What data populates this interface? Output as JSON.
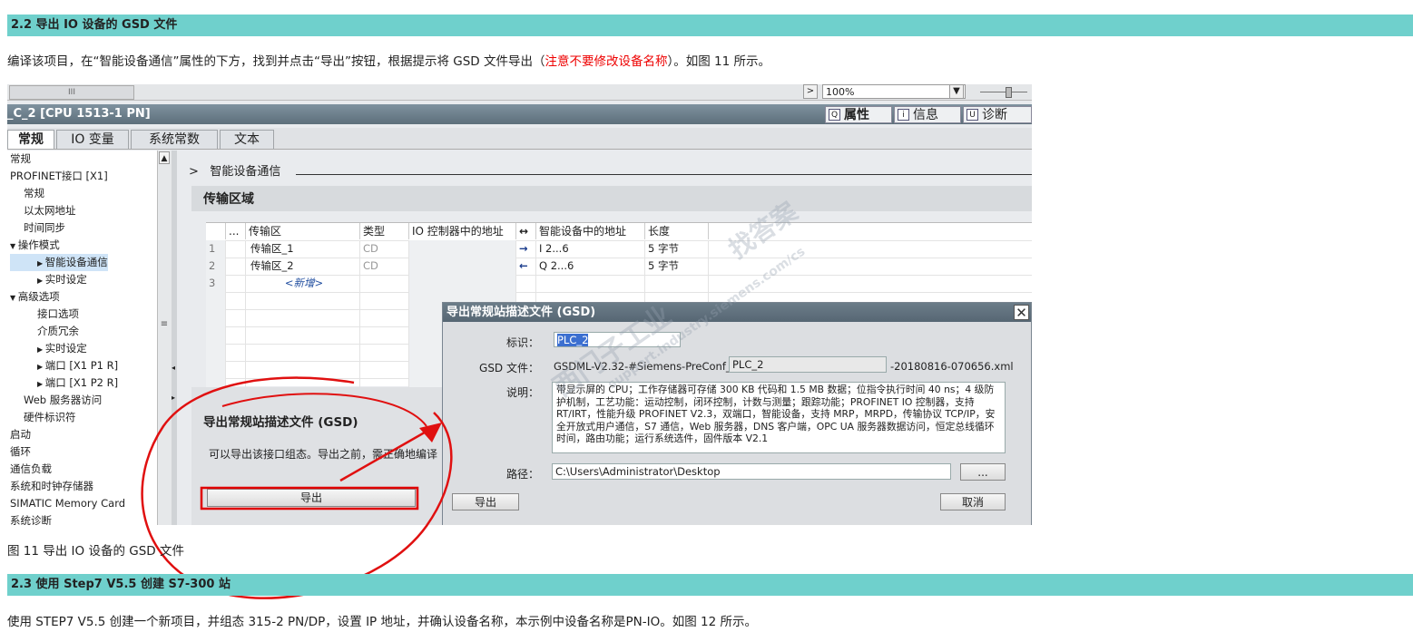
{
  "sec1": {
    "title": "2.2 导出 IO 设备的 GSD 文件"
  },
  "intro": {
    "before": "编译该项目，在“智能设备通信”属性的下方，找到并点击“导出”按钮，根据提示将 GSD 文件导出（",
    "red": "注意不要修改设备名称",
    "after": "）。如图 11 所示。"
  },
  "toolbar": {
    "scroll_glyph": "III",
    "nav_arrow": ">",
    "zoom": "100%",
    "zoom_arrow": "▼"
  },
  "window": {
    "title": "_C_2 [CPU 1513-1 PN]"
  },
  "panel_tabs": [
    {
      "icon": "Q",
      "label": "属性"
    },
    {
      "icon": "i",
      "label": "信息"
    },
    {
      "icon": "U",
      "label": "诊断"
    }
  ],
  "tabs": [
    "常规",
    "IO 变量",
    "系统常数",
    "文本"
  ],
  "tree": [
    {
      "label": "常规",
      "indent": 0,
      "arrow": ""
    },
    {
      "label": "PROFINET接口 [X1]",
      "indent": 0,
      "arrow": ""
    },
    {
      "label": "常规",
      "indent": 1,
      "arrow": ""
    },
    {
      "label": "以太网地址",
      "indent": 1,
      "arrow": ""
    },
    {
      "label": "时间同步",
      "indent": 1,
      "arrow": ""
    },
    {
      "label": "操作模式",
      "indent": 0,
      "arrow": "▼"
    },
    {
      "label": "智能设备通信",
      "indent": 2,
      "arrow": "▶",
      "selected": true
    },
    {
      "label": "实时设定",
      "indent": 2,
      "arrow": "▶"
    },
    {
      "label": "高级选项",
      "indent": 0,
      "arrow": "▼"
    },
    {
      "label": "接口选项",
      "indent": 2,
      "arrow": ""
    },
    {
      "label": "介质冗余",
      "indent": 2,
      "arrow": ""
    },
    {
      "label": "实时设定",
      "indent": 2,
      "arrow": "▶"
    },
    {
      "label": "端口 [X1 P1 R]",
      "indent": 2,
      "arrow": "▶"
    },
    {
      "label": "端口 [X1 P2 R]",
      "indent": 2,
      "arrow": "▶"
    },
    {
      "label": "Web 服务器访问",
      "indent": 1,
      "arrow": ""
    },
    {
      "label": "硬件标识符",
      "indent": 1,
      "arrow": ""
    },
    {
      "label": "启动",
      "indent": 0,
      "arrow": ""
    },
    {
      "label": "循环",
      "indent": 0,
      "arrow": ""
    },
    {
      "label": "通信负载",
      "indent": 0,
      "arrow": ""
    },
    {
      "label": "系统和时钟存储器",
      "indent": 0,
      "arrow": ""
    },
    {
      "label": "SIMATIC Memory Card",
      "indent": 0,
      "arrow": ""
    },
    {
      "label": "系统诊断",
      "indent": 0,
      "arrow": ""
    }
  ],
  "content": {
    "breadcrumb_arrow": ">",
    "breadcrumb": "智能设备通信",
    "section_title": "传输区域",
    "export_title": "导出常规站描述文件 (GSD)",
    "export_desc": "可以导出该接口组态。导出之前，需正确地编译",
    "export_button": "导出"
  },
  "grid": {
    "headers": [
      "",
      "...",
      "传输区",
      "类型",
      "IO 控制器中的地址",
      "↔",
      "智能设备中的地址",
      "长度"
    ],
    "rows": [
      {
        "num": "1",
        "name": "传输区_1",
        "type": "CD",
        "dir": "→",
        "addr": "I 2...6",
        "len": "5 字节"
      },
      {
        "num": "2",
        "name": "传输区_2",
        "type": "CD",
        "dir": "←",
        "addr": "Q 2...6",
        "len": "5 字节"
      },
      {
        "num": "3",
        "name": "<新增>",
        "type": "",
        "dir": "",
        "addr": "",
        "len": ""
      }
    ]
  },
  "dialog": {
    "title": "导出常规站描述文件 (GSD)",
    "close": "✕",
    "id_label": "标识：",
    "id_value": "PLC_2",
    "gsd_label": "GSD 文件：",
    "gsd_prefix": "GSDML-V2.32-#Siemens-PreConf_",
    "gsd_name": "PLC_2",
    "gsd_suffix": "-20180816-070656.xml",
    "desc_label": "说明：",
    "desc_text": "带显示屏的 CPU；工作存储器可存储 300 KB 代码和 1.5 MB 数据；位指令执行时间 40 ns；4 级防护机制，工艺功能：运动控制，闭环控制，计数与测量；跟踪功能；PROFINET IO 控制器，支持 RT/IRT，性能升级 PROFINET V2.3，双端口，智能设备，支持 MRP，MRPD，传输协议 TCP/IP，安全开放式用户通信，S7 通信，Web 服务器，DNS 客户端，OPC UA 服务器数据访问，恒定总线循环时间，路由功能；运行系统选件，固件版本 V2.1",
    "path_label": "路径：",
    "path_value": "C:\\Users\\Administrator\\Desktop",
    "browse": "...",
    "export": "导出",
    "cancel": "取消"
  },
  "watermark": [
    "找答案",
    "西门子工业",
    "support.industry.siemens.com/cs"
  ],
  "caption": "图 11 导出 IO 设备的 GSD 文件",
  "sec2": {
    "title": "2.3 使用 Step7 V5.5 创建 S7-300 站"
  },
  "outro": "使用 STEP7 V5.5 创建一个新项目，并组态 315-2 PN/DP，设置 IP 地址，并确认设备名称，本示例中设备名称是PN-IO。如图 12 所示。",
  "colors": {
    "section_bar": "#6fd0cc",
    "annotation": "#e01010",
    "highlight": "#e00000"
  }
}
